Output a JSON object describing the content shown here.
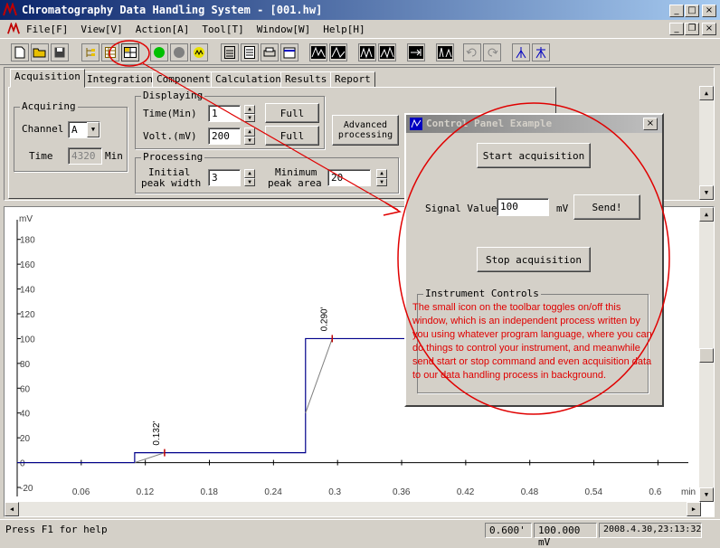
{
  "window": {
    "title": "Chromatography Data Handling System - [001.hw]",
    "min": "_",
    "max": "□",
    "close": "×"
  },
  "menu": [
    "File[F]",
    "View[V]",
    "Action[A]",
    "Tool[T]",
    "Window[W]",
    "Help[H]"
  ],
  "mdi": {
    "min": "_",
    "restore": "❐",
    "close": "×"
  },
  "tabs": [
    "Acquisition",
    "Integration",
    "Component",
    "Calculation",
    "Results",
    "Report"
  ],
  "acquiring": {
    "title": "Acquiring",
    "channel_label": "Channel",
    "channel_value": "A",
    "time_label": "Time",
    "time_value": "4320",
    "time_unit": "Min"
  },
  "displaying": {
    "title": "Displaying",
    "time_label": "Time(Min)",
    "time_value": "1",
    "volt_label": "Volt.(mV)",
    "volt_value": "200",
    "full1": "Full",
    "full2": "Full"
  },
  "advanced": "Advanced processing",
  "processing": {
    "title": "Processing",
    "initial_label1": "Initial",
    "initial_label2": "peak width",
    "initial_value": "3",
    "min_label1": "Minimum",
    "min_label2": "peak area",
    "min_value": "20"
  },
  "dialog": {
    "title": "Control Panel Example",
    "start": "Start acquisition",
    "signal_label": "Signal Value",
    "signal_value": "100",
    "signal_unit": "mV",
    "send": "Send!",
    "stop": "Stop acquisition",
    "instrument": "Instrument Controls"
  },
  "annotation": "The small icon on the toolbar toggles on/off this window, which is an independent process written by you using whatever program language, where you can do things to control your instrument, and meanwhile send start or stop command and even acquisition data to our data handling process in background.",
  "status": {
    "help": "Press F1 for help",
    "time": "0.600'",
    "mv": "100.000 mV",
    "datetime": "2008.4.30,23:13:32"
  },
  "chart_data": {
    "type": "line",
    "ylabel": "mV",
    "xlabel": "min",
    "xlim": [
      0,
      0.62
    ],
    "ylim": [
      -20,
      190
    ],
    "yticks": [
      -20,
      0,
      20,
      40,
      60,
      80,
      100,
      120,
      140,
      160,
      180
    ],
    "xticks": [
      0.06,
      0.12,
      0.18,
      0.24,
      0.3,
      0.36,
      0.42,
      0.48,
      0.54,
      0.6
    ],
    "xtick_labels": [
      "0.06",
      "0.12",
      "0.18",
      "0.24",
      "0.3",
      "0.36",
      "0.42",
      "0.48",
      "0.54",
      "0.6"
    ],
    "series": [
      {
        "x": [
          0,
          0.11,
          0.11,
          0.27,
          0.27,
          0.6
        ],
        "y": [
          0,
          0,
          8,
          8,
          100,
          100
        ],
        "color": "#00008b"
      }
    ],
    "baselines": [
      {
        "x": [
          0.11,
          0.138
        ],
        "y": [
          0,
          8
        ]
      },
      {
        "x": [
          0.27,
          0.295
        ],
        "y": [
          40,
          100
        ]
      }
    ],
    "peaks": [
      {
        "x": 0.138,
        "y": 8,
        "label": "0.132'"
      },
      {
        "x": 0.295,
        "y": 100,
        "label": "0.290'"
      }
    ]
  },
  "colors": {
    "title": "#0a246a",
    "annotation": "#e00000",
    "trace": "#00008b"
  }
}
